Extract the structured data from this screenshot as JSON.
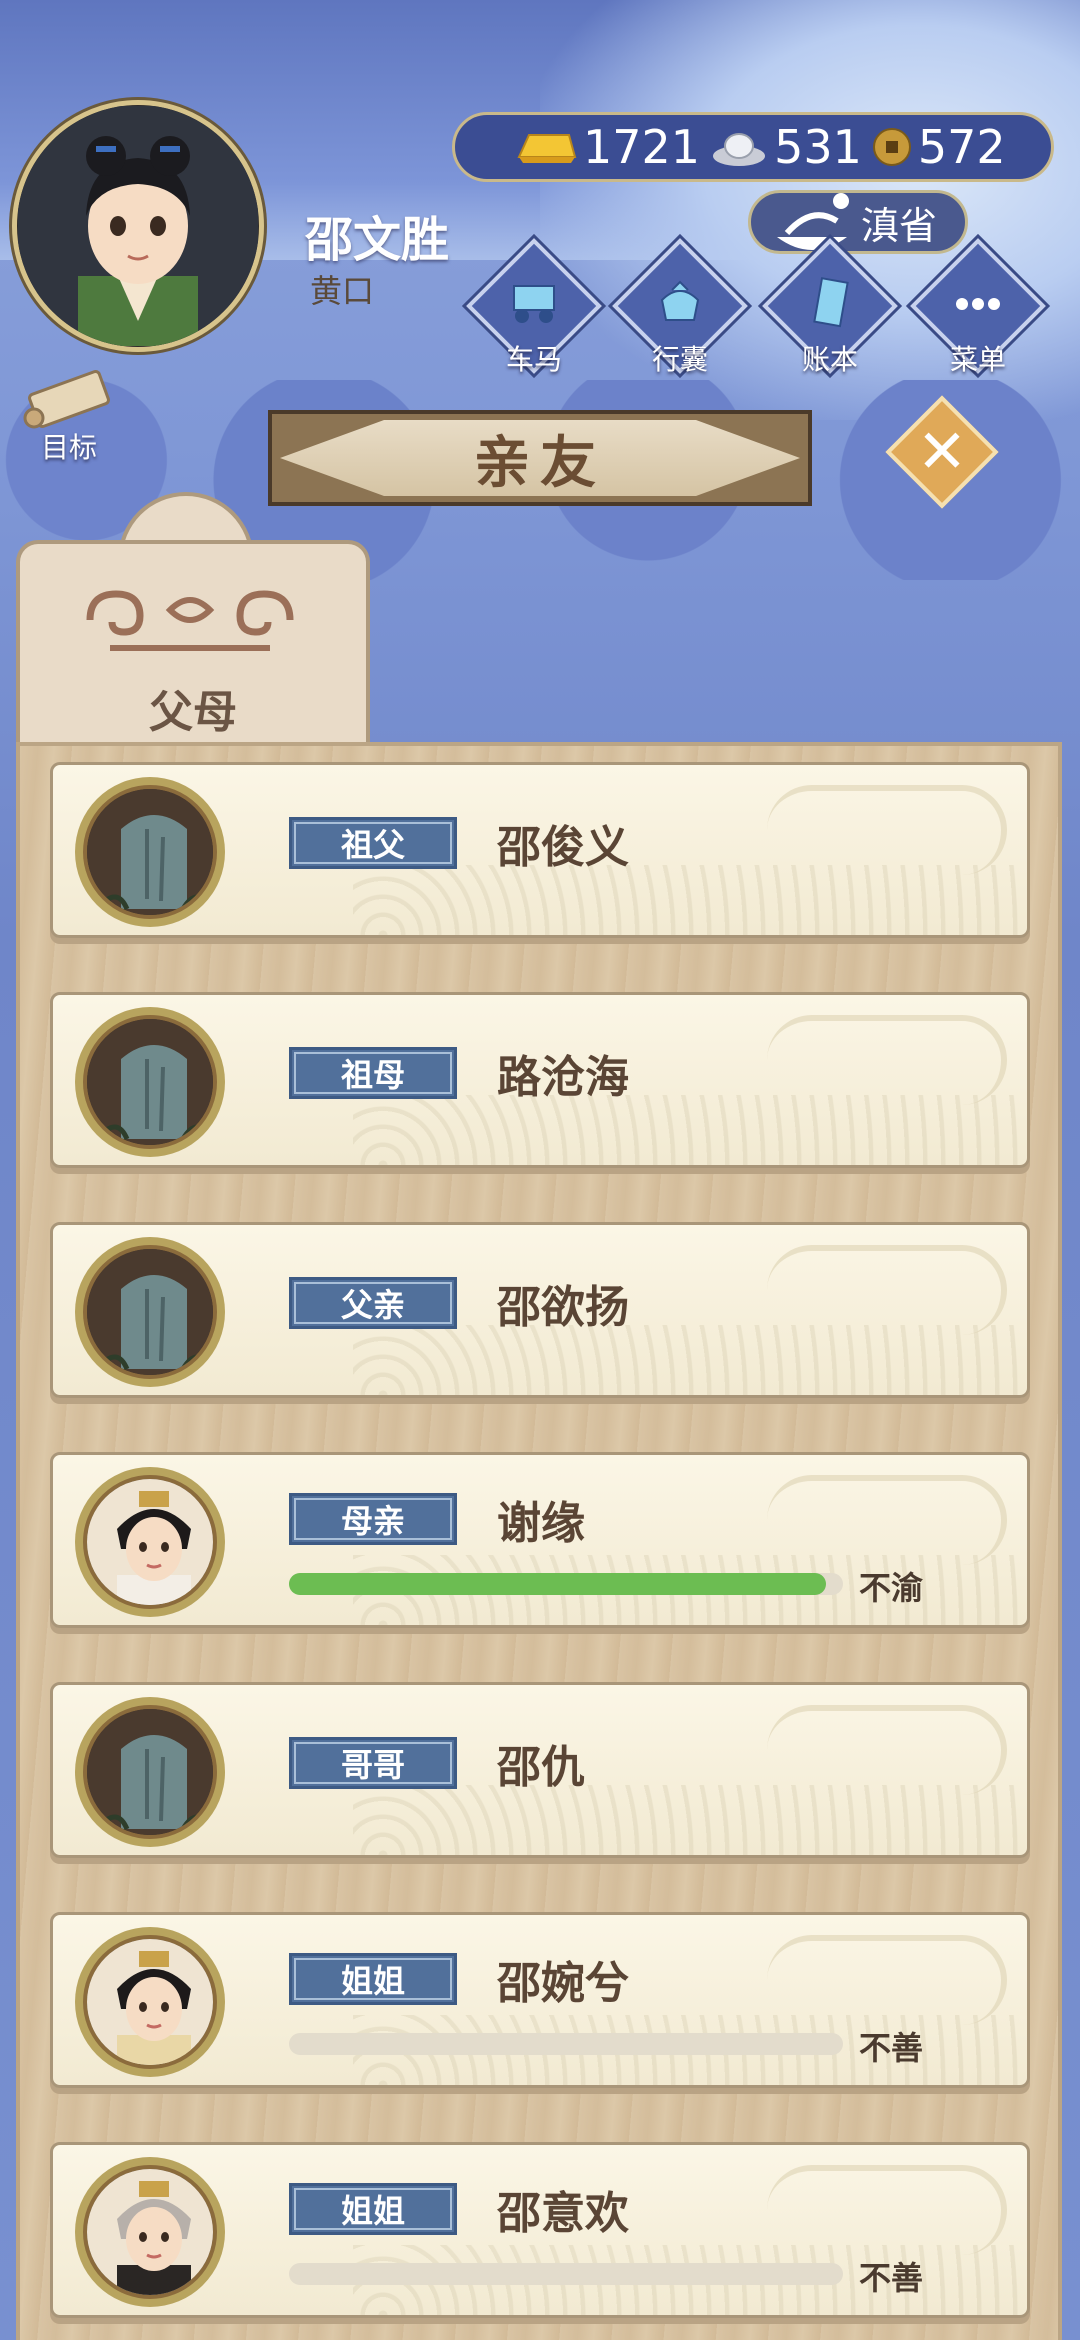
{
  "player": {
    "name": "邵文胜",
    "status": "黄口"
  },
  "currency": {
    "gold": "1721",
    "silver": "531",
    "coin": "572"
  },
  "location": "滇省",
  "actions": [
    {
      "label": "车马",
      "icon": "carriage-icon"
    },
    {
      "label": "行囊",
      "icon": "bundle-icon"
    },
    {
      "label": "账本",
      "icon": "ledger-icon"
    },
    {
      "label": "菜单",
      "icon": "menu-dots-icon"
    }
  ],
  "goal_label": "目标",
  "title": "亲友",
  "tab_label": "父母",
  "relatives": [
    {
      "role": "祖父",
      "name": "邵俊义",
      "portrait": "tombstone",
      "mood": null,
      "mood_value": null
    },
    {
      "role": "祖母",
      "name": "路沧海",
      "portrait": "tombstone",
      "mood": null,
      "mood_value": null
    },
    {
      "role": "父亲",
      "name": "邵欲扬",
      "portrait": "tombstone",
      "mood": null,
      "mood_value": null
    },
    {
      "role": "母亲",
      "name": "谢缘",
      "portrait": "woman",
      "mood": "不渝",
      "mood_value": 0.97
    },
    {
      "role": "哥哥",
      "name": "邵仇",
      "portrait": "tombstone",
      "mood": null,
      "mood_value": null
    },
    {
      "role": "姐姐",
      "name": "邵婉兮",
      "portrait": "young-woman",
      "mood": "不善",
      "mood_value": 0.0
    },
    {
      "role": "姐姐",
      "name": "邵意欢",
      "portrait": "old-woman",
      "mood": "不善",
      "mood_value": 0.0
    }
  ],
  "colors": {
    "mood_fill": "#6cbd52",
    "role_tag": "#51709b",
    "panel_wood": "#d9c4a4"
  }
}
